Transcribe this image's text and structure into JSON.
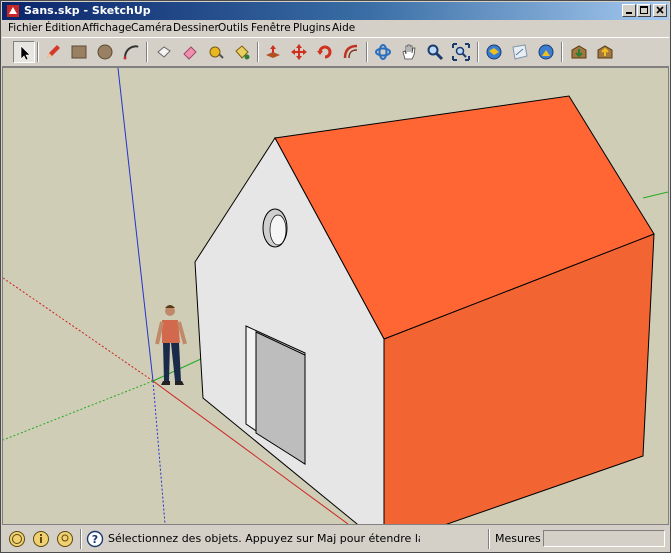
{
  "window": {
    "title": "Sans.skp - SketchUp",
    "minimize_icon": "minimize-icon",
    "maximize_icon": "maximize-icon",
    "close_icon": "close-icon"
  },
  "menu": [
    "Fichier",
    "Édition",
    "Affichage",
    "Caméra",
    "Dessiner",
    "Outils",
    "Fenêtre",
    "Plugins",
    "Aide"
  ],
  "toolbar": [
    {
      "name": "select-tool",
      "icon": "arrow-cursor-icon",
      "active": true
    },
    {
      "name": "line-tool",
      "icon": "pencil-icon"
    },
    {
      "name": "rectangle-tool",
      "icon": "rectangle-icon"
    },
    {
      "name": "circle-tool",
      "icon": "circle-icon"
    },
    {
      "name": "arc-tool",
      "icon": "arc-icon"
    },
    {
      "name": "make-component-tool",
      "icon": "component-icon"
    },
    {
      "name": "eraser-tool",
      "icon": "eraser-icon"
    },
    {
      "name": "tape-measure-tool",
      "icon": "tape-measure-icon"
    },
    {
      "name": "paint-bucket-tool",
      "icon": "paint-bucket-icon"
    },
    {
      "name": "push-pull-tool",
      "icon": "push-pull-icon"
    },
    {
      "name": "move-tool",
      "icon": "move-arrows-icon"
    },
    {
      "name": "rotate-tool",
      "icon": "rotate-icon"
    },
    {
      "name": "offset-tool",
      "icon": "offset-icon"
    },
    {
      "name": "orbit-tool",
      "icon": "orbit-icon"
    },
    {
      "name": "pan-tool",
      "icon": "hand-icon"
    },
    {
      "name": "zoom-tool",
      "icon": "magnifier-icon"
    },
    {
      "name": "zoom-extents-tool",
      "icon": "zoom-extents-icon"
    },
    {
      "name": "previous-view-tool",
      "icon": "globe-previous-icon"
    },
    {
      "name": "next-view-tool",
      "icon": "next-view-icon"
    },
    {
      "name": "share-model-tool",
      "icon": "globe-share-icon"
    },
    {
      "name": "components-3d-warehouse-tool",
      "icon": "warehouse-download-icon"
    },
    {
      "name": "share-component-tool",
      "icon": "warehouse-upload-icon"
    }
  ],
  "colors": {
    "roof": "#ff6633",
    "wall_light": "#e6e6e6",
    "wall_orange": "#f26532",
    "ground": "#d0cdb6",
    "door": "#bdbdbd"
  },
  "status": {
    "icons": [
      "geo-location-icon",
      "credits-icon",
      "user-icon"
    ],
    "help_icon": "help-icon",
    "message": "Sélectionnez des objets. Appuyez sur Maj pour étendre la sélec",
    "measures_label": "Mesures",
    "measures_value": ""
  }
}
